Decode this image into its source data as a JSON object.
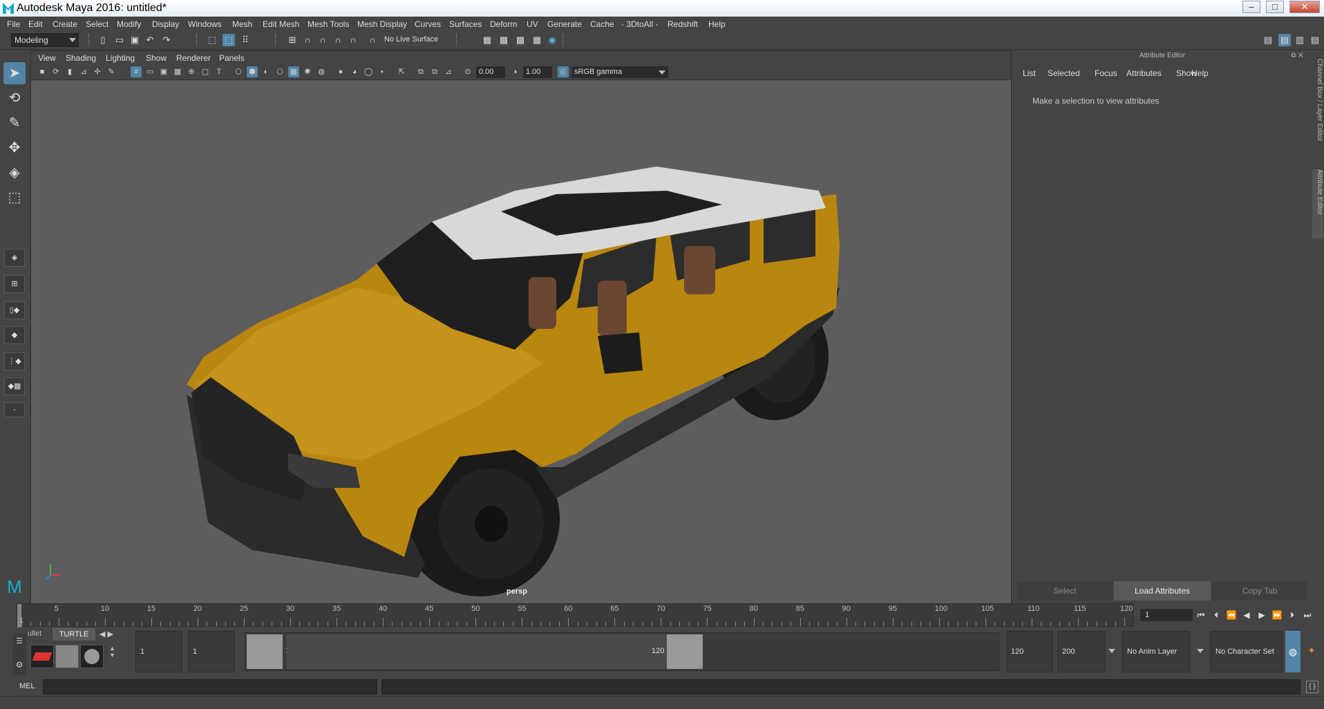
{
  "window": {
    "title": "Autodesk Maya 2016: untitled*"
  },
  "menu": [
    "File",
    "Edit",
    "Create",
    "Select",
    "Modify",
    "Display",
    "Windows",
    "Mesh",
    "Edit Mesh",
    "Mesh Tools",
    "Mesh Display",
    "Curves",
    "Surfaces",
    "Deform",
    "UV",
    "Generate",
    "Cache",
    "- 3DtoAll -",
    "Redshift",
    "Help"
  ],
  "statusline": {
    "mode": "Modeling",
    "live_surface": "No Live Surface"
  },
  "panel": {
    "menu": [
      "View",
      "Shading",
      "Lighting",
      "Show",
      "Renderer",
      "Panels"
    ],
    "exposure": "0.00",
    "gamma": "1.00",
    "colorspace": "sRGB gamma",
    "camera_label": "persp"
  },
  "attribute_editor": {
    "title": "Attribute Editor",
    "menu": [
      "List",
      "Selected",
      "Focus",
      "Attributes",
      "Show",
      "Help"
    ],
    "message": "Make a selection to view attributes",
    "buttons": {
      "select": "Select",
      "load": "Load Attributes",
      "copy": "Copy Tab"
    }
  },
  "right_tabs": {
    "channel_box": "Channel Box / Layer Editor",
    "attribute_editor": "Attribute Editor"
  },
  "timeline": {
    "labels": [
      "5",
      "10",
      "15",
      "20",
      "25",
      "30",
      "35",
      "40",
      "45",
      "50",
      "55",
      "60",
      "65",
      "70",
      "75",
      "80",
      "85",
      "90",
      "95",
      "100",
      "105",
      "110",
      "115",
      "120"
    ],
    "first_label": "1",
    "current_frame": "1"
  },
  "range": {
    "start": "1",
    "playback_start": "1",
    "slider_start": "1",
    "slider_end": "120",
    "playback_end": "120",
    "end": "200",
    "anim_layer": "No Anim Layer",
    "character_set": "No Character Set"
  },
  "shelf": {
    "tab_partial": "ullet",
    "tab_turtle": "TURTLE"
  },
  "cmdline": {
    "label": "MEL"
  },
  "colors": {
    "accent": "#5285a6",
    "body": "#b9870f",
    "roof": "#d8d8d8",
    "viewport": "#5d5d5d"
  }
}
